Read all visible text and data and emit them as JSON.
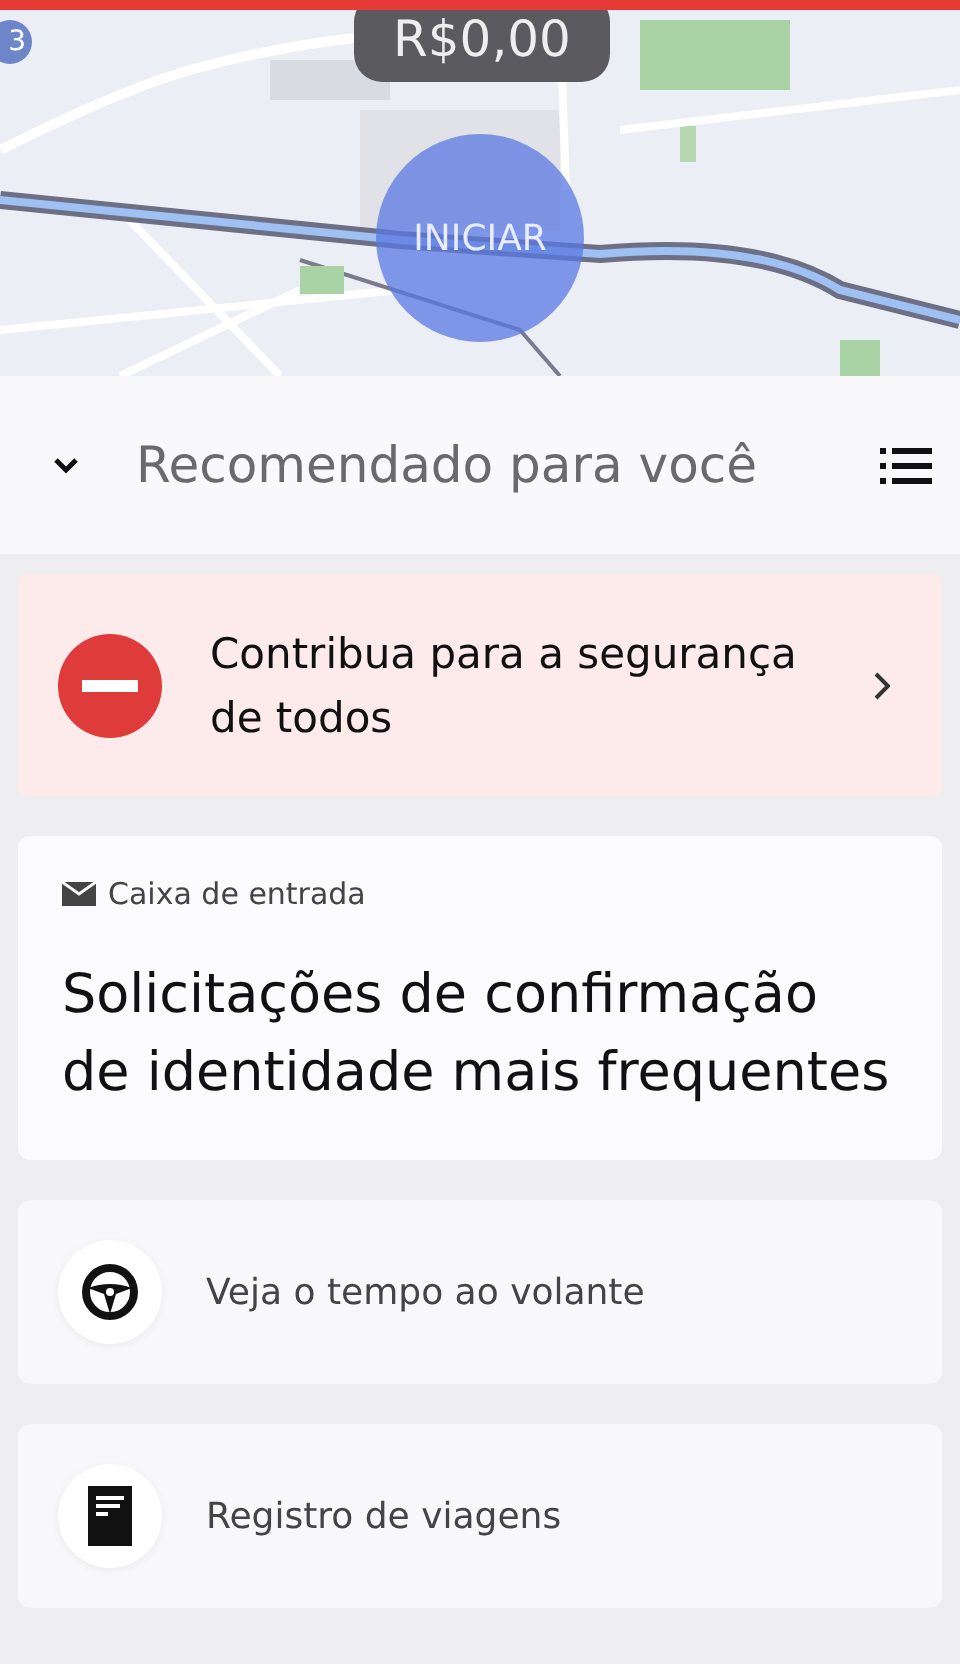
{
  "map": {
    "earnings": "R$0,00",
    "start_button": "INICIAR",
    "badge": "3"
  },
  "header": {
    "title": "Recomendado para você"
  },
  "alert": {
    "text": "Contribua para a segurança de todos"
  },
  "inbox": {
    "label": "Caixa de entrada",
    "title": "Solicitações de confirmação de identidade mais frequentes"
  },
  "items": [
    {
      "kind": "wheel",
      "label": "Veja o tempo ao volante"
    },
    {
      "kind": "document",
      "label": "Registro de viagens"
    }
  ]
}
